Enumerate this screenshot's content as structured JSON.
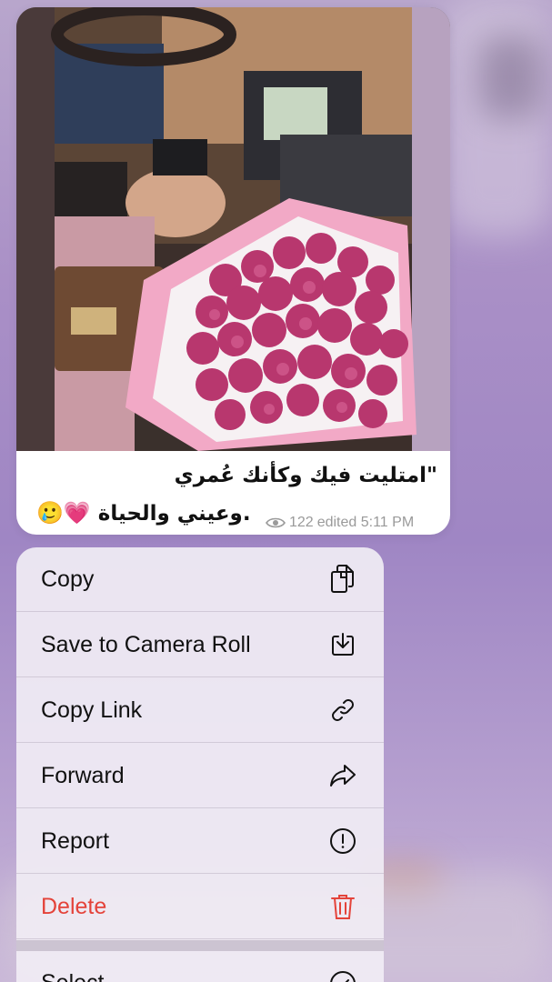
{
  "message": {
    "caption_line1": "\"امتليت فيك وكأنك عُمري",
    "caption_line2_text": "وعيني والحياة.",
    "caption_line2_emojis": "🥲💗",
    "views": "122",
    "edited_time": "edited 5:11 PM",
    "views_icon": "eye-icon"
  },
  "menu": {
    "items": [
      {
        "label": "Copy",
        "icon": "copy-icon"
      },
      {
        "label": "Save to Camera Roll",
        "icon": "download-icon"
      },
      {
        "label": "Copy Link",
        "icon": "link-icon"
      },
      {
        "label": "Forward",
        "icon": "forward-icon"
      },
      {
        "label": "Report",
        "icon": "exclamation-icon"
      },
      {
        "label": "Delete",
        "icon": "trash-icon"
      }
    ],
    "select": {
      "label": "Select",
      "icon": "checkmark-circle-icon"
    }
  },
  "colors": {
    "danger": "#e4433a",
    "menu_bg": "#f0ecf4",
    "backdrop": "#a98fc6"
  }
}
